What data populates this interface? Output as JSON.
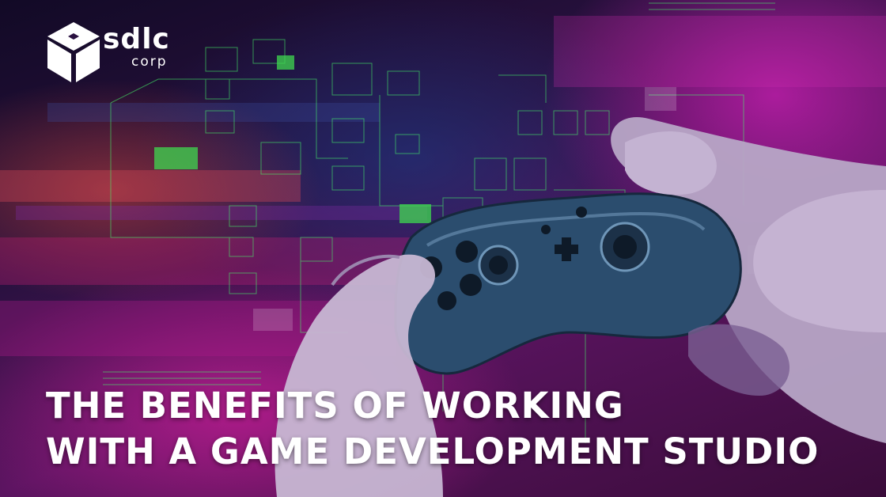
{
  "brand": {
    "name": "sdlc",
    "sub": "corp",
    "logo_icon": "cube-icon"
  },
  "headline": {
    "line1": "THE BENEFITS OF WORKING",
    "line2": "WITH A GAME DEVELOPMENT STUDIO"
  },
  "illustration": {
    "subject": "gamepad-controller-icon"
  },
  "colors": {
    "magenta": "#c21ea8",
    "circuit_green": "#39ff5a",
    "controller_blue": "#2b4d6e",
    "text": "#ffffff"
  }
}
